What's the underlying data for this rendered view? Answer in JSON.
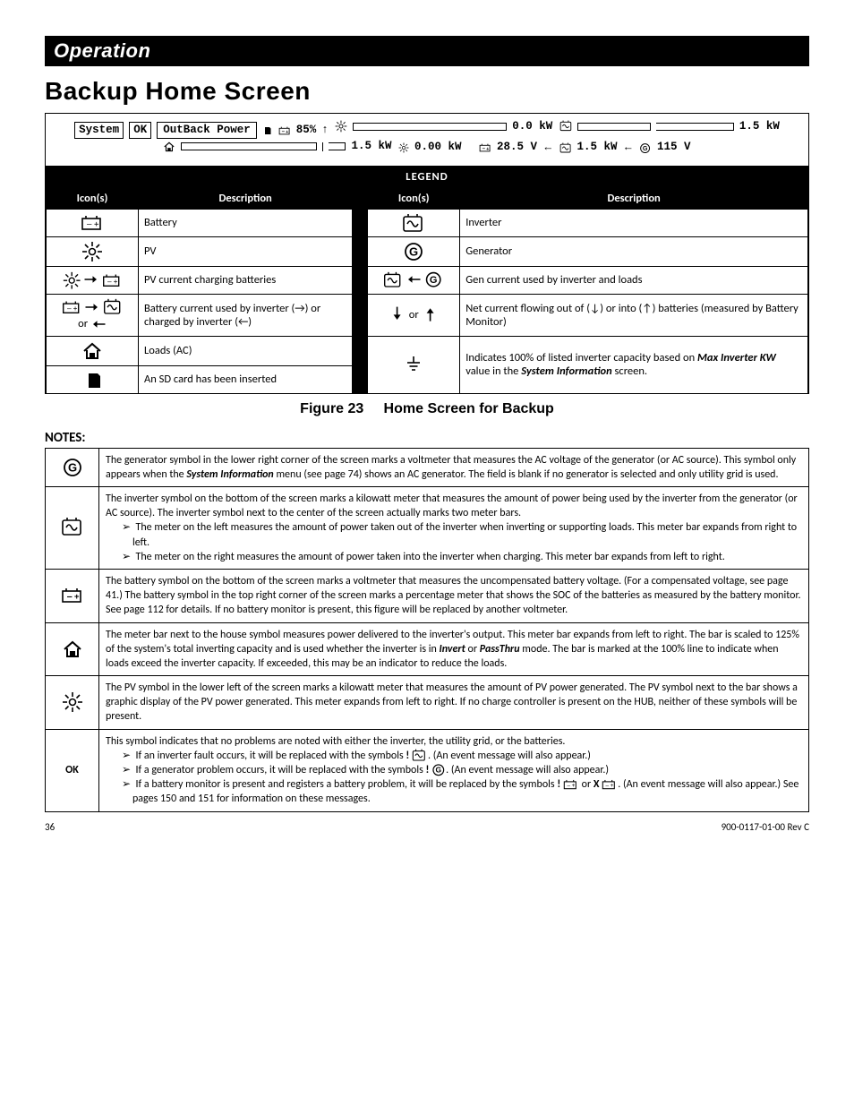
{
  "header": {
    "bar": "Operation",
    "title": "Backup Home Screen"
  },
  "lcd": {
    "system": "System",
    "ok": "OK",
    "brand": "OutBack Power",
    "soc": "85%",
    "kw0": "0.0 kW",
    "kw1": "1.5 kW",
    "kw2": "1.5 kW",
    "pvkw": "0.00 kW",
    "batv": "28.5 V",
    "invkw": "1.5 kW",
    "genv": "115 V"
  },
  "legend": {
    "title": "LEGEND",
    "h_icon": "Icon(s)",
    "h_desc": "Description",
    "battery": "Battery",
    "pv": "PV",
    "pv_charge": "PV current charging batteries",
    "bat_inv_1": "Battery current used by inverter (→) or charged by inverter (←)",
    "or": "or",
    "loads": "Loads (AC)",
    "sd": "An SD card has been inserted",
    "inverter": "Inverter",
    "generator": "Generator",
    "gen_inv": "Gen current used by inverter and loads",
    "net_cur": "Net current flowing out of (↓) or into (↑) batteries (measured by Battery Monitor)",
    "cap100_a": "Indicates 100% of listed inverter capacity based on ",
    "cap100_b": "Max Inverter KW",
    "cap100_c": " value in the ",
    "cap100_d": "System Information",
    "cap100_e": " screen."
  },
  "figure": {
    "label": "Figure 23",
    "caption": "Home Screen for Backup"
  },
  "notes_heading": "Notes:",
  "notes": {
    "gen_a": "The generator symbol in the lower right corner of the screen marks a voltmeter that measures the AC voltage of the generator (or AC source).  This symbol only appears when the ",
    "gen_b": "System Information",
    "gen_c": " menu (see page 74) shows an AC generator.  The field is blank if no generator is selected and only utility grid is used.",
    "inv_a": "The inverter symbol on the bottom of the screen marks a kilowatt meter that measures the amount of power being used by the inverter from the generator (or AC source).  The inverter symbol next to the center of the screen actually marks two meter bars.",
    "inv_b": "The meter on the left measures the amount of power taken out of the inverter when inverting or supporting loads. This meter bar expands from right to left.",
    "inv_c": "The meter on the right measures the amount of power taken into the inverter when charging. This meter bar expands from left to right.",
    "bat": "The battery symbol on the bottom of the screen marks a voltmeter that measures the uncompensated battery voltage.  (For a compensated voltage, see page 41.)  The battery symbol in the top right corner of the screen marks a percentage meter that shows the SOC of the batteries as measured by the battery monitor.  See page 112 for details.  If no battery monitor is present, this figure will be replaced by another voltmeter.",
    "loads_a": "The meter bar next to the house symbol measures power delivered to the inverter's output.  This meter bar expands from left to right.  The bar is scaled to 125% of the system's total inverting capacity and is used whether the inverter is in ",
    "loads_b": "Invert",
    "loads_c": " or ",
    "loads_d": "PassThru",
    "loads_e": " mode.  The bar is marked at the 100% line to indicate when loads exceed the inverter capacity.  If exceeded, this may be an indicator to reduce the loads.",
    "pv": "The PV symbol in the lower left of the screen marks a kilowatt meter that measures the amount of PV power generated.  The PV symbol next to the bar shows a graphic display of the PV power generated.  This meter expands from left to right.  If no charge controller is present on the HUB, neither of these symbols will be present.",
    "ok_label": "OK",
    "ok_a": "This symbol indicates that no problems are noted with either the inverter, the utility grid, or the batteries.",
    "ok_b1": "If an inverter fault occurs, it will be replaced with the symbols ",
    "ok_b2": ".  (An event message will also appear.)",
    "ok_c1": "If a generator problem occurs, it will be replaced with the symbols ",
    "ok_c2": ".  (An event message will also appear.)",
    "ok_d1": "If a battery monitor is present and registers a battery problem, it will be replaced by the symbols ",
    "ok_d_or": " or ",
    "ok_d2": ". (An event message will also appear.)  See pages 150 and 151 for information on these messages."
  },
  "footer": {
    "page": "36",
    "rev": "900-0117-01-00 Rev C"
  }
}
